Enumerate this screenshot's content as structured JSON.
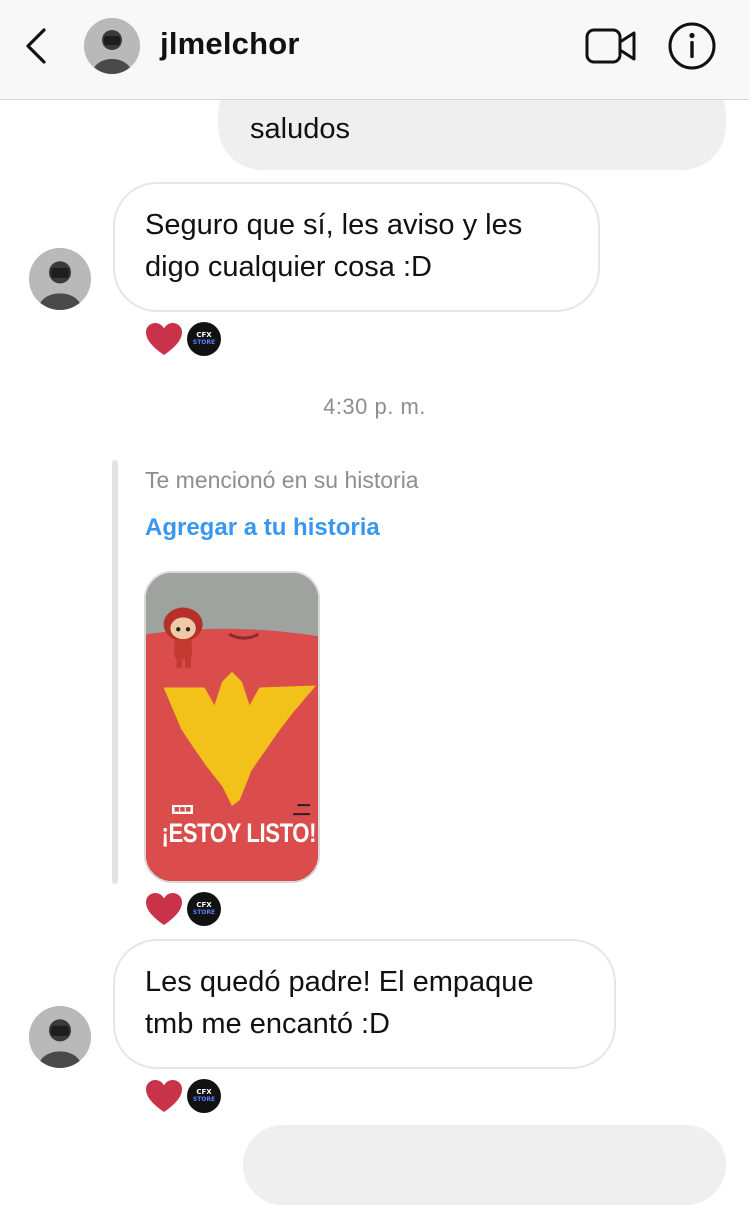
{
  "header": {
    "username": "jlmelchor"
  },
  "messages": {
    "outgoing_top": "saludos",
    "incoming_1_line1": "Seguro que sí, les aviso y les",
    "incoming_1_line2": "digo cualquier cosa :D",
    "incoming_2_line1": "Les quedó padre! El empaque",
    "incoming_2_line2": "tmb me encantó :D"
  },
  "timestamp": "4:30 p. m.",
  "story_reply": {
    "mention_text": "Te mencionó en su historia",
    "add_to_story": "Agregar a tu historia",
    "headline": "¡ESTOY LISTO!"
  },
  "reaction_badge": {
    "top": "CFX",
    "bottom": "STORE"
  },
  "colors": {
    "link_blue": "#3897f0",
    "heart_red": "#c8334a",
    "story_red": "#d94a4a",
    "phoenix_yellow": "#f2c21b",
    "outgoing_bubble": "#efefef"
  },
  "icons": [
    "back-chevron-icon",
    "video-call-icon",
    "info-icon",
    "heart-icon"
  ]
}
